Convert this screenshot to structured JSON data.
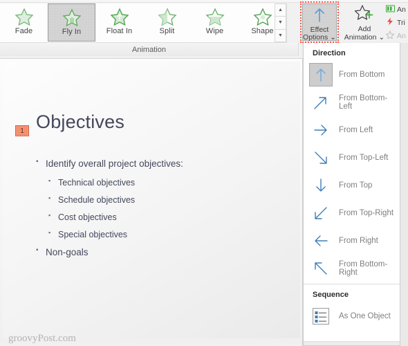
{
  "ribbon": {
    "group_label": "Animation",
    "gallery": [
      {
        "label": "Fade",
        "icon": "star-fade-icon",
        "selected": false
      },
      {
        "label": "Fly In",
        "icon": "star-flyin-icon",
        "selected": true
      },
      {
        "label": "Float In",
        "icon": "star-floatin-icon",
        "selected": false
      },
      {
        "label": "Split",
        "icon": "star-split-icon",
        "selected": false
      },
      {
        "label": "Wipe",
        "icon": "star-wipe-icon",
        "selected": false
      },
      {
        "label": "Shape",
        "icon": "star-shape-icon",
        "selected": false
      }
    ],
    "gallery_scroll": {
      "up": "scroll-up-icon",
      "down": "scroll-down-icon",
      "more": "more-gallery-icon"
    },
    "effect_options": {
      "line1": "Effect",
      "line2": "Options",
      "dropdown_caret": "⌄",
      "icon": "arrow-up-icon",
      "highlight_color": "#F8574A",
      "active": true
    },
    "add_animation": {
      "line1": "Add",
      "line2": "Animation",
      "dropdown_caret": "⌄",
      "icon": "star-plus-icon"
    },
    "right_commands": [
      {
        "label": "An",
        "icon": "animation-pane-icon",
        "disabled": false
      },
      {
        "label": "Tri",
        "icon": "trigger-icon",
        "disabled": false
      },
      {
        "label": "An",
        "icon": "animation-painter-icon",
        "disabled": true
      }
    ]
  },
  "effect_menu": {
    "direction_title": "Direction",
    "directions": [
      {
        "label": "From Bottom",
        "accel": "B",
        "icon": "arrow-up-icon",
        "selected": true
      },
      {
        "label": "From Bottom-Left",
        "accel": "f",
        "icon": "arrow-up-right-icon",
        "selected": false
      },
      {
        "label": "From Left",
        "accel": "L",
        "icon": "arrow-right-icon",
        "selected": false
      },
      {
        "label": "From Top-Left",
        "accel": "f",
        "icon": "arrow-down-right-icon",
        "selected": false
      },
      {
        "label": "From Top",
        "accel": "T",
        "icon": "arrow-down-icon",
        "selected": false
      },
      {
        "label": "From Top-Right",
        "accel": "g",
        "icon": "arrow-down-left-icon",
        "selected": false
      },
      {
        "label": "From Right",
        "accel": "R",
        "icon": "arrow-left-icon",
        "selected": false
      },
      {
        "label": "From Bottom-Right",
        "accel": "R",
        "icon": "arrow-up-left-icon",
        "selected": false
      }
    ],
    "sequence_title": "Sequence",
    "sequence": [
      {
        "label": "As One Object",
        "accel": "n",
        "icon": "as-one-object-icon",
        "selected": false
      }
    ]
  },
  "slide": {
    "animation_badge": "1",
    "title": "Objectives",
    "bullets": [
      {
        "level": 1,
        "text": "Identify overall project objectives:"
      },
      {
        "level": 2,
        "text": "Technical objectives"
      },
      {
        "level": 2,
        "text": "Schedule objectives"
      },
      {
        "level": 2,
        "text": "Cost objectives"
      },
      {
        "level": 2,
        "text": "Special objectives"
      },
      {
        "level": 1,
        "text": "Non-goals"
      }
    ],
    "watermark": "groovyPost.com"
  }
}
